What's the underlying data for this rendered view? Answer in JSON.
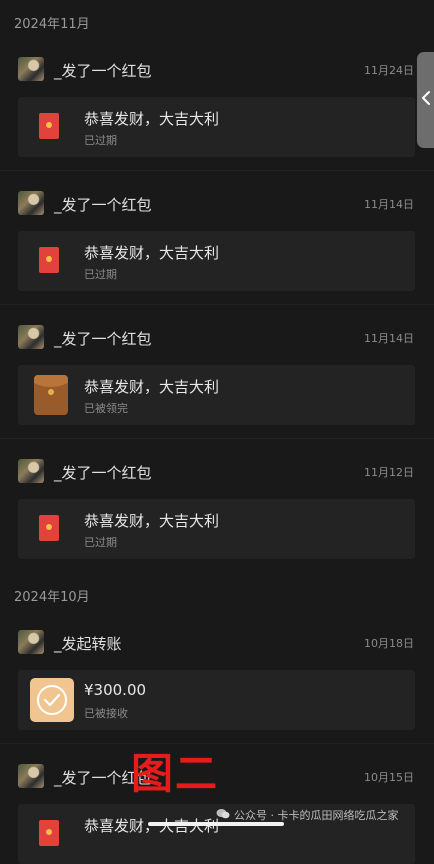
{
  "months": [
    "2024年11月",
    "2024年10月"
  ],
  "entries": [
    {
      "sender": "_发了一个红包",
      "date": "11月24日",
      "title": "恭喜发财，大吉大利",
      "status": "已过期",
      "icon": "red-envelope-icon"
    },
    {
      "sender": "_发了一个红包",
      "date": "11月14日",
      "title": "恭喜发财，大吉大利",
      "status": "已过期",
      "icon": "red-envelope-icon"
    },
    {
      "sender": "_发了一个红包",
      "date": "11月14日",
      "title": "恭喜发财，大吉大利",
      "status": "已被领完",
      "icon": "opened-envelope-icon"
    },
    {
      "sender": "_发了一个红包",
      "date": "11月12日",
      "title": "恭喜发财，大吉大利",
      "status": "已过期",
      "icon": "red-envelope-icon"
    },
    {
      "sender": "_发起转账",
      "date": "10月18日",
      "title": "¥300.00",
      "status": "已被接收",
      "icon": "transfer-check-icon"
    },
    {
      "sender": "_发了一个红包",
      "date": "10月15日",
      "title": "恭喜发财，大吉大利",
      "status": "",
      "icon": "red-envelope-icon"
    }
  ],
  "watermark": {
    "big": "图二",
    "small": "公众号 · 卡卡的瓜田网络吃瓜之家"
  },
  "side_tab_icon": "chevron-left-icon",
  "colors": {
    "background": "#191919",
    "card": "#232323",
    "envelope_red": "#e2423b",
    "transfer": "#f0c58f",
    "watermark_red": "#e51c1c"
  }
}
